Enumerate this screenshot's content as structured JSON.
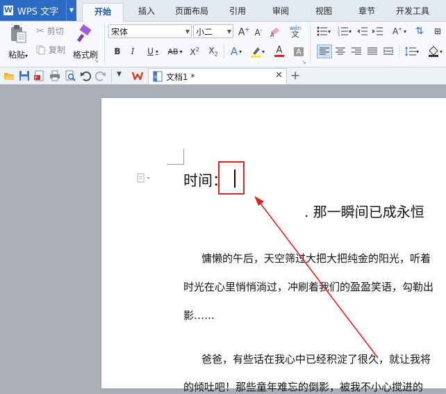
{
  "app": {
    "title": "WPS 文字"
  },
  "tabs": [
    {
      "label": "开始",
      "active": true
    },
    {
      "label": "插入"
    },
    {
      "label": "页面布局"
    },
    {
      "label": "引用"
    },
    {
      "label": "审阅"
    },
    {
      "label": "视图"
    },
    {
      "label": "章节"
    },
    {
      "label": "开发工具"
    }
  ],
  "clipboard": {
    "paste": "粘贴",
    "cut": "剪切",
    "copy": "复制",
    "format_painter": "格式刷"
  },
  "font": {
    "name": "宋体",
    "size": "小二"
  },
  "document_tab": {
    "name": "文档1 *"
  },
  "document": {
    "heading": "时间：",
    "subtitle": ". 那一瞬间已成永恒",
    "p1_line1": "慵懒的午后，天空筛过大把大把纯金的阳光，听着",
    "p1_line2": "时光在心里悄悄淌过，冲刷着我们的盈盈笑语，勾勒出",
    "p1_line3": "影……",
    "p2_line1": "爸爸，有些话在我心中已经积淀了很久，就让我将",
    "p2_line2": "的倾吐吧！那些童年难忘的倒影，被我不小心搅进的"
  },
  "colors": {
    "accent": "#2b6bc6",
    "annotation": "#e02020"
  }
}
